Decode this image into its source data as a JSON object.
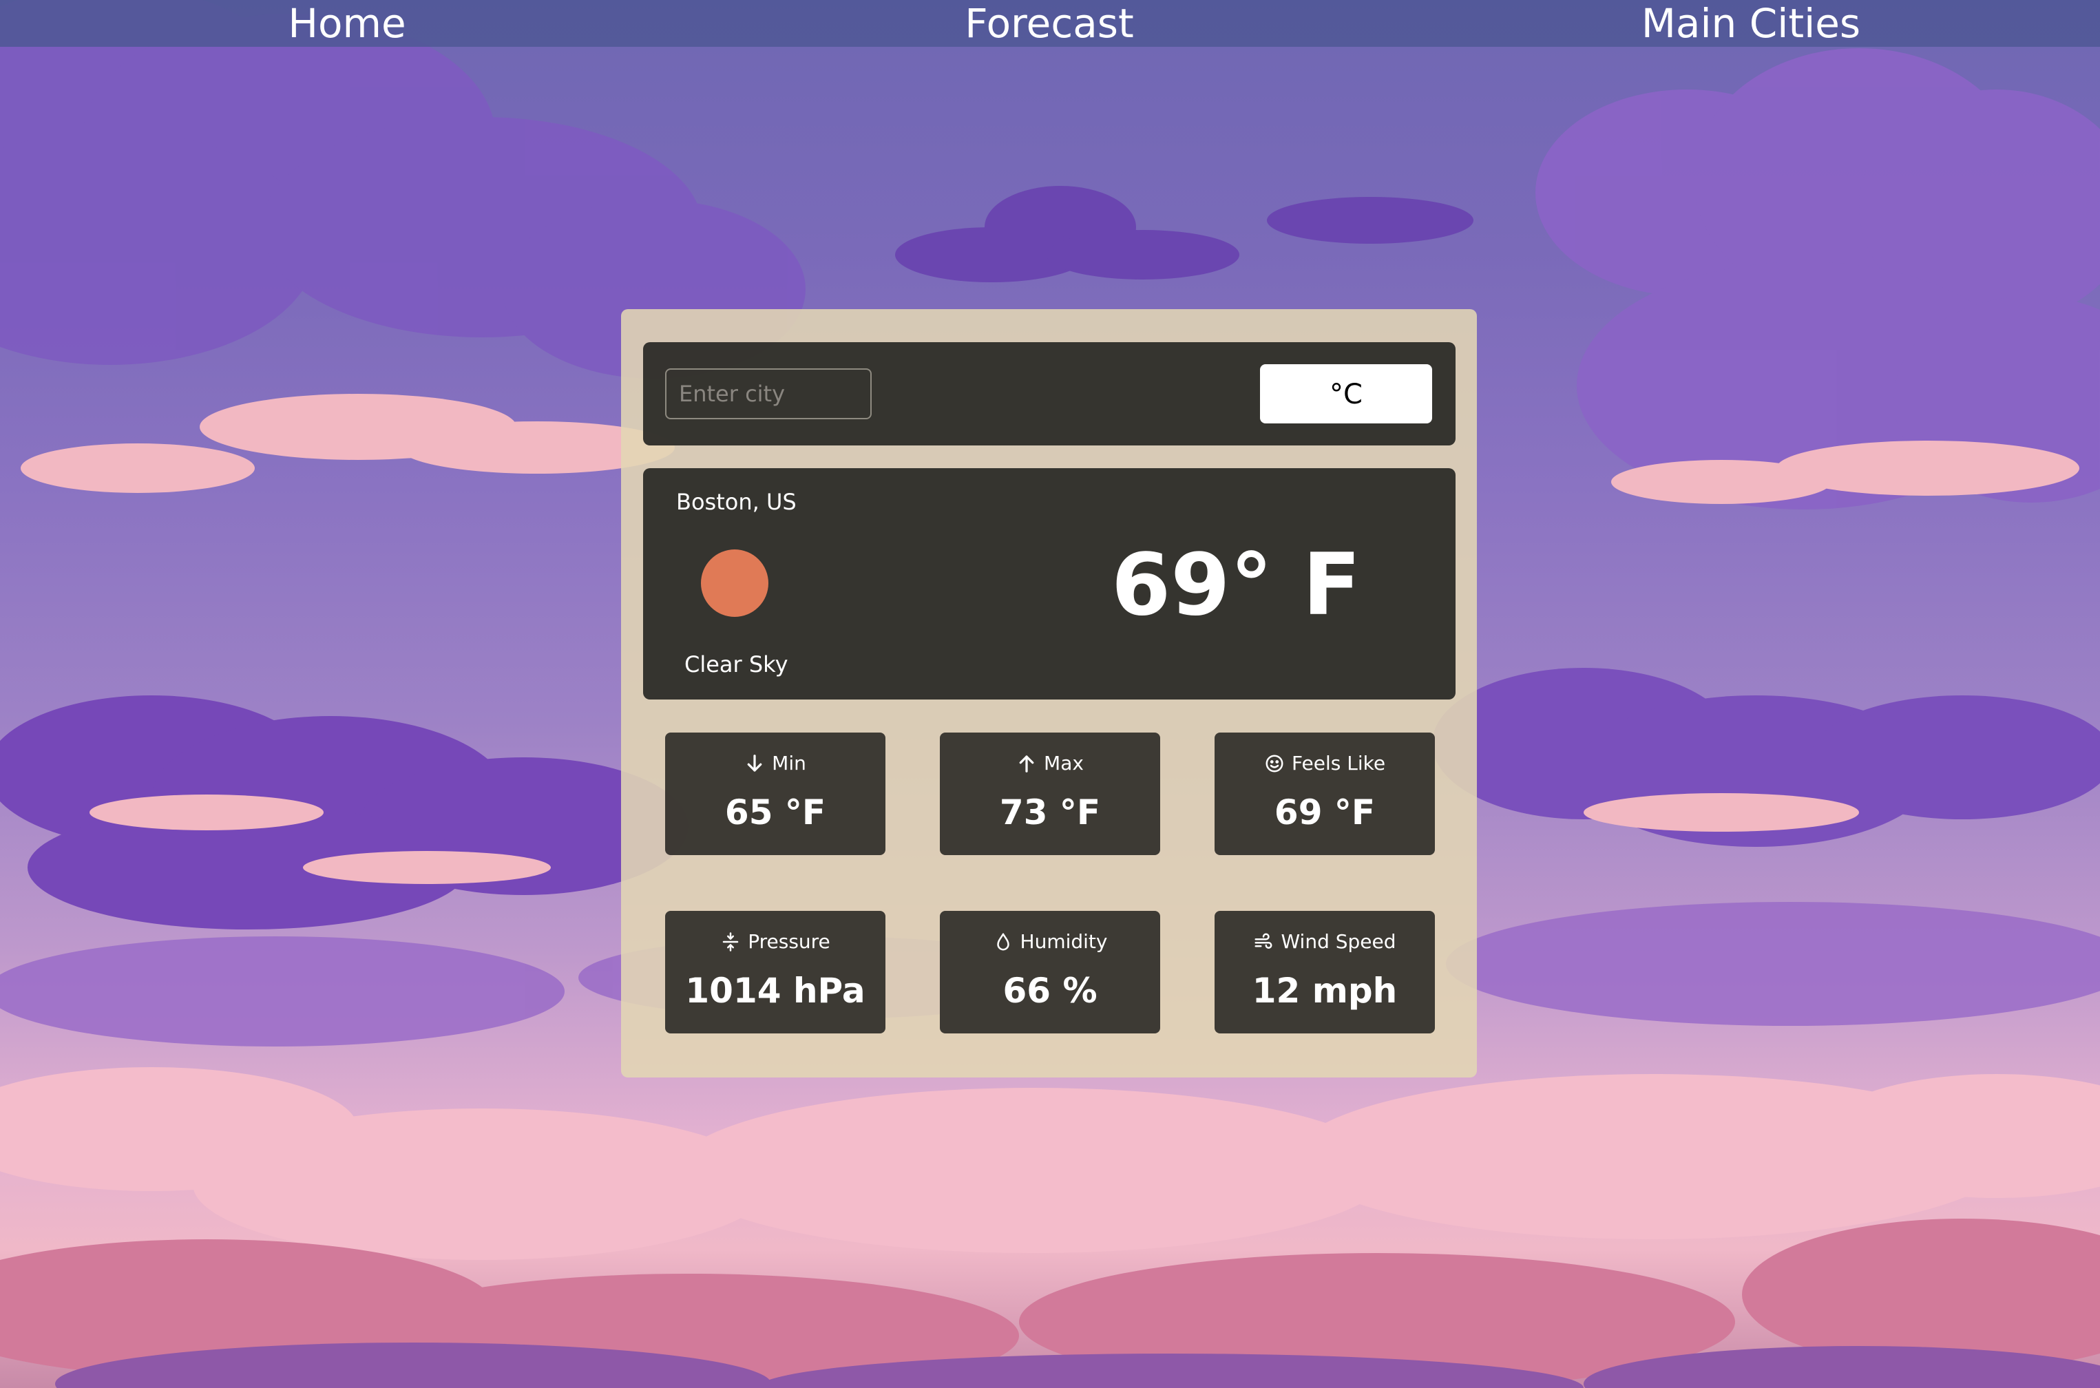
{
  "nav": {
    "home": "Home",
    "forecast": "Forecast",
    "main_cities": "Main Cities"
  },
  "search": {
    "placeholder": "Enter city",
    "value": "",
    "unit_toggle_label": "°C"
  },
  "current": {
    "location": "Boston, US",
    "condition": "Clear Sky",
    "temperature": "69° F",
    "icon": "sun-icon",
    "icon_color": "#e07a56"
  },
  "stats": {
    "min": {
      "label": "Min",
      "value": "65 °F",
      "icon": "arrow-down-icon"
    },
    "max": {
      "label": "Max",
      "value": "73 °F",
      "icon": "arrow-up-icon"
    },
    "feels_like": {
      "label": "Feels Like",
      "value": "69 °F",
      "icon": "smile-icon"
    },
    "pressure": {
      "label": "Pressure",
      "value": "1014 hPa",
      "icon": "compress-icon"
    },
    "humidity": {
      "label": "Humidity",
      "value": "66 %",
      "icon": "droplet-icon"
    },
    "wind_speed": {
      "label": "Wind Speed",
      "value": "12 mph",
      "icon": "wind-icon"
    }
  },
  "colors": {
    "nav_bg": "#505896",
    "panel_bg": "#e2d6b4",
    "card_bg": "#302e2a",
    "sky_top": "#6f67b3",
    "sky_bottom": "#f0b8c8"
  }
}
